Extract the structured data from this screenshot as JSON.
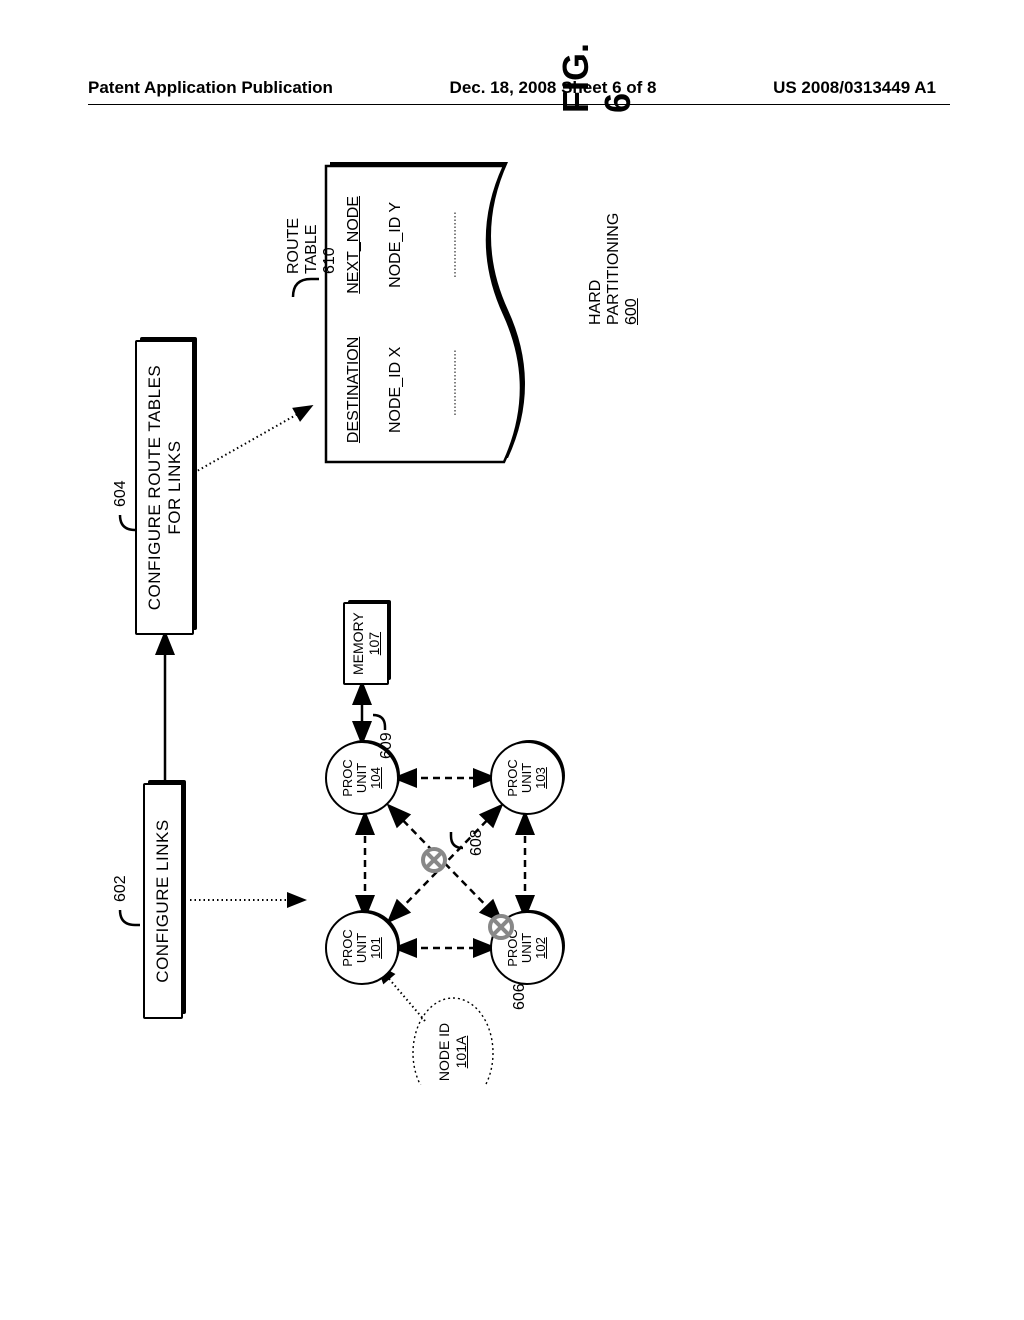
{
  "header": {
    "left": "Patent Application Publication",
    "center": "Dec. 18, 2008  Sheet 6 of 8",
    "right": "US 2008/0313449 A1"
  },
  "boxes": {
    "configure_links": "CONFIGURE LINKS",
    "configure_routes_line1": "CONFIGURE ROUTE TABLES",
    "configure_routes_line2": "FOR LINKS"
  },
  "refs": {
    "r602": "602",
    "r604": "604",
    "route_table": "ROUTE TABLE 610",
    "r606": "606",
    "r608": "608",
    "r609": "609"
  },
  "nodes": {
    "proc": "PROC",
    "unit": "UNIT",
    "n101": "101",
    "n102": "102",
    "n103": "103",
    "n104": "104",
    "memory": "MEMORY",
    "m107": "107",
    "nodeid_label": "NODE ID",
    "nodeid_val": "101A"
  },
  "table": {
    "col1": "DESTINATION",
    "col2": "NEXT_NODE",
    "row1a": "NODE_ID X",
    "row1b": "NODE_ID Y"
  },
  "labels": {
    "hard_partitioning": "HARD PARTITIONING",
    "hp_ref": "600",
    "figure": "FIG. 6"
  }
}
